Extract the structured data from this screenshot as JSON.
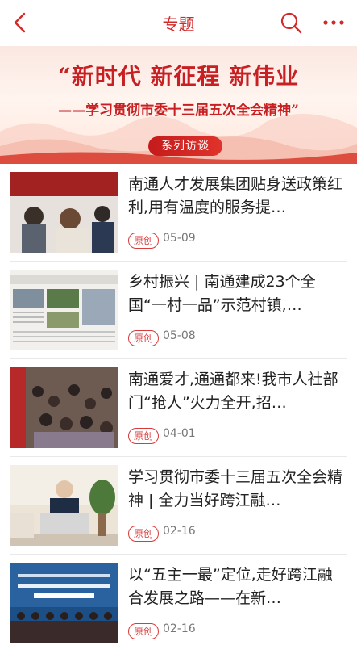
{
  "header": {
    "title": "专题",
    "back_icon": "chevron-left-icon",
    "search_icon": "search-icon",
    "more_icon": "more-horizontal-icon",
    "accent": "#d22a2a"
  },
  "banner": {
    "line1": "“新时代 新征程 新伟业",
    "line2": "——学习贯彻市委十三届五次全会精神”",
    "badge": "系列访谈"
  },
  "articles": [
    {
      "title": "南通人才发展集团贴身送政策红利,用有温度的服务提…",
      "tag": "原创",
      "date": "05-09"
    },
    {
      "title": "乡村振兴 | 南通建成23个全国“一村一品”示范村镇,…",
      "tag": "原创",
      "date": "05-08"
    },
    {
      "title": "南通爱才,通通都来!我市人社部门“抢人”火力全开,招…",
      "tag": "原创",
      "date": "04-01"
    },
    {
      "title": "学习贯彻市委十三届五次全会精神 | 全力当好跨江融…",
      "tag": "原创",
      "date": "02-16"
    },
    {
      "title": "以“五主一最”定位,走好跨江融合发展之路——在新…",
      "tag": "原创",
      "date": "02-16"
    }
  ]
}
